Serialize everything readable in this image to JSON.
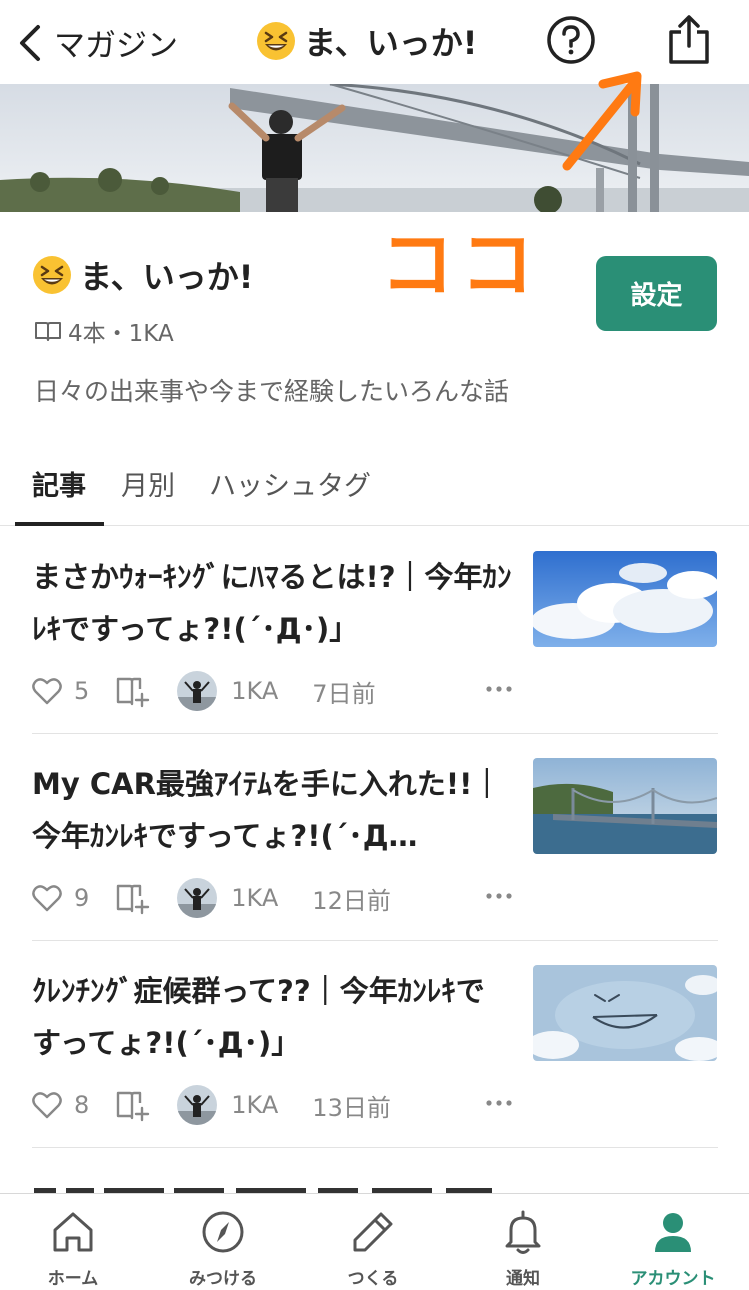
{
  "nav": {
    "back_label": "マガジン",
    "title": "ま、いっか!"
  },
  "annotation": {
    "text": "ココ"
  },
  "magazine": {
    "title": "ま、いっか!",
    "meta": "4本・1KA",
    "description": "日々の出来事や今まで経験したいろんな話",
    "settings_label": "設定"
  },
  "tabs": [
    {
      "label": "記事",
      "active": true
    },
    {
      "label": "月別",
      "active": false
    },
    {
      "label": "ハッシュタグ",
      "active": false
    }
  ],
  "articles": [
    {
      "title": "まさかｳｫｰｷﾝｸﾞにﾊﾏるとは!?｜今年ｶﾝﾚｷですってょ?!(´･Д･)」",
      "likes": "5",
      "author": "1KA",
      "date": "7日前",
      "thumb": "sky-clouds"
    },
    {
      "title": "My CAR最強ｱｲﾃﾑを手に入れた!!｜今年ｶﾝﾚｷですってょ?!(´･Д…",
      "likes": "9",
      "author": "1KA",
      "date": "12日前",
      "thumb": "bridge"
    },
    {
      "title": "ｸﾚﾝﾁﾝｸﾞ症候群って??｜今年ｶﾝﾚｷですってょ?!(´･Д･)」",
      "likes": "8",
      "author": "1KA",
      "date": "13日前",
      "thumb": "smiley-cloud"
    }
  ],
  "bottom_nav": [
    {
      "label": "ホーム",
      "icon": "home-icon",
      "active": false
    },
    {
      "label": "みつける",
      "icon": "compass-icon",
      "active": false
    },
    {
      "label": "つくる",
      "icon": "pencil-icon",
      "active": false
    },
    {
      "label": "通知",
      "icon": "bell-icon",
      "active": false
    },
    {
      "label": "アカウント",
      "icon": "account-icon",
      "active": true
    }
  ],
  "colors": {
    "accent": "#2a8f76",
    "annotation": "#ff7a12"
  }
}
